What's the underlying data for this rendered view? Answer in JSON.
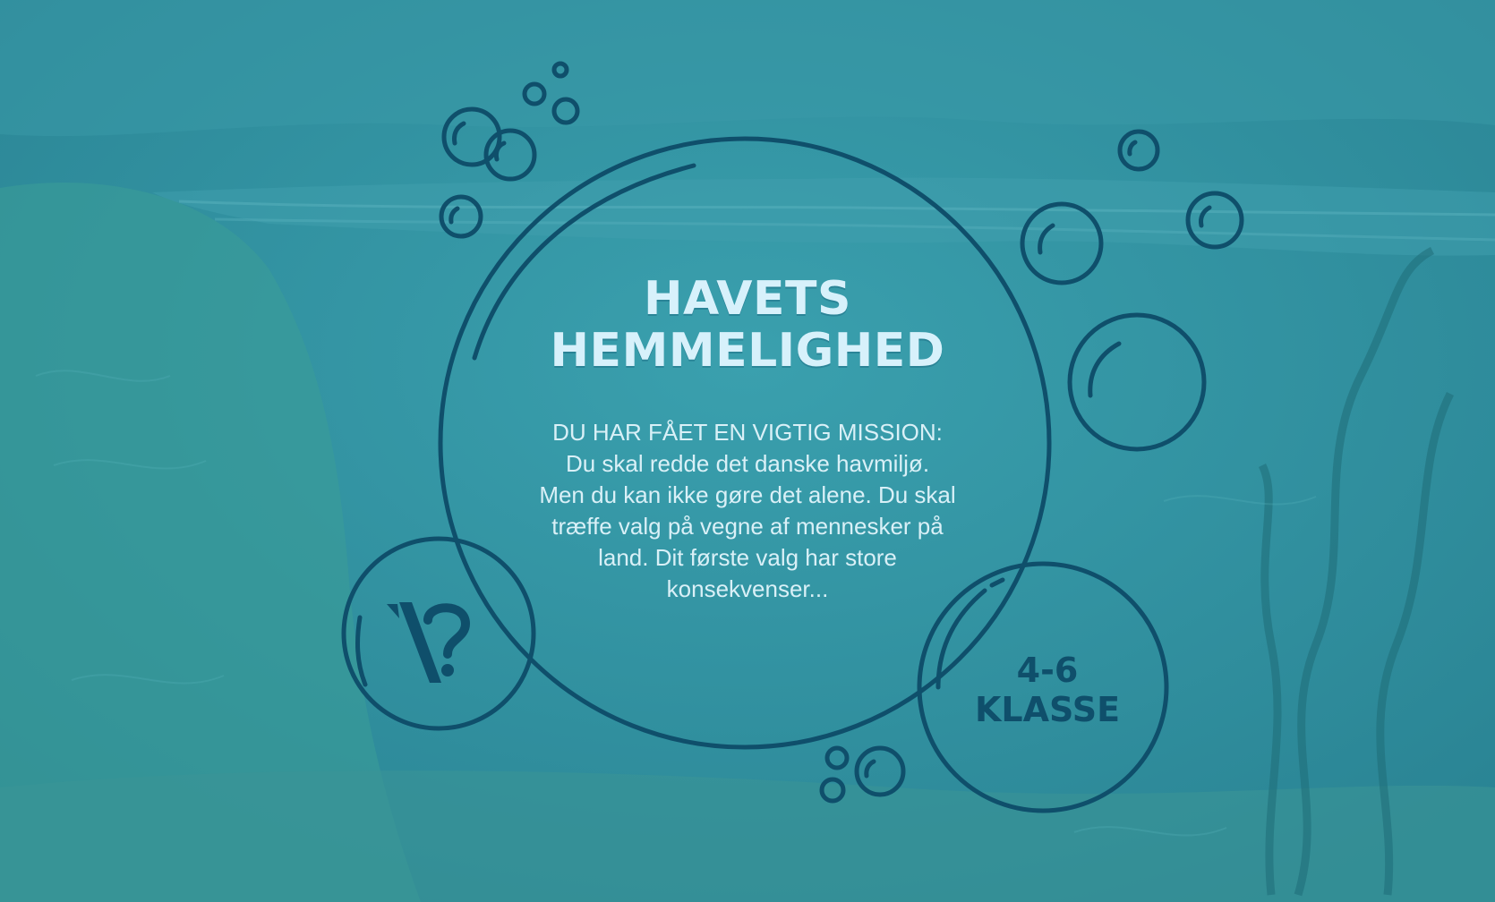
{
  "game": {
    "title_line1": "HAVETS",
    "title_line2": "HEMMELIGHED",
    "mission_lines": [
      "DU HAR FÅET EN VIGTIG MISSION:",
      "Du skal redde det danske havmiljø.",
      "Men du kan ikke gøre det alene. Du skal",
      "træffe valg på vegne af mennesker på",
      "land. Dit første valg har store",
      "konsekvenser..."
    ],
    "grade_line1": "4-6",
    "grade_line2": "KLASSE",
    "logo_icon": "question-logo-icon"
  },
  "colors": {
    "water": "#2f8f9f",
    "outline": "#0f4f6b",
    "title_text": "#d7f1fb"
  }
}
